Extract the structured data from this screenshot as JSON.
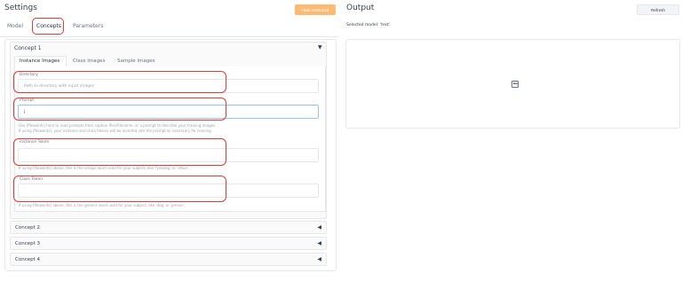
{
  "settings": {
    "title": "Settings",
    "hide_advanced_label": "Hide Advanced"
  },
  "tabs": [
    {
      "label": "Model"
    },
    {
      "label": "Concepts"
    },
    {
      "label": "Parameters"
    }
  ],
  "concepts": {
    "concept1": {
      "title": "Concept 1",
      "subtabs": [
        {
          "label": "Instance Images"
        },
        {
          "label": "Class Images"
        },
        {
          "label": "Sample Images"
        }
      ],
      "fields": {
        "directory": {
          "label": "Directory",
          "placeholder": "Path to directory with input images"
        },
        "prompt": {
          "label": "Prompt",
          "value": "|",
          "hint1": "Use [filewords] here to read prompts from caption files/filename, or a prompt to describe your training images.",
          "hint2": "If using [filewords], your instance and class tokens will be inserted into the prompt as necessary for training."
        },
        "instance_token": {
          "label": "Instance Token",
          "hint": "If using [filewords] above, this is the unique word used for your subject, like 'fydodog' or 'ohwx'."
        },
        "class_token": {
          "label": "Class Token",
          "hint": "If using [filewords] above, this is the generic word used for your subject, like 'dog' or 'person'."
        }
      }
    },
    "collapsed": [
      {
        "title": "Concept 2"
      },
      {
        "title": "Concept 3"
      },
      {
        "title": "Concept 4"
      }
    ]
  },
  "output": {
    "title": "Output",
    "refresh_label": "Refresh",
    "selected_model": "Selected model: 'test'."
  },
  "icons": {
    "expanded_arrow": "▼",
    "collapsed_arrow": "◀"
  },
  "colors": {
    "accent_orange": "#fdba74",
    "highlight_red": "#e53935"
  }
}
